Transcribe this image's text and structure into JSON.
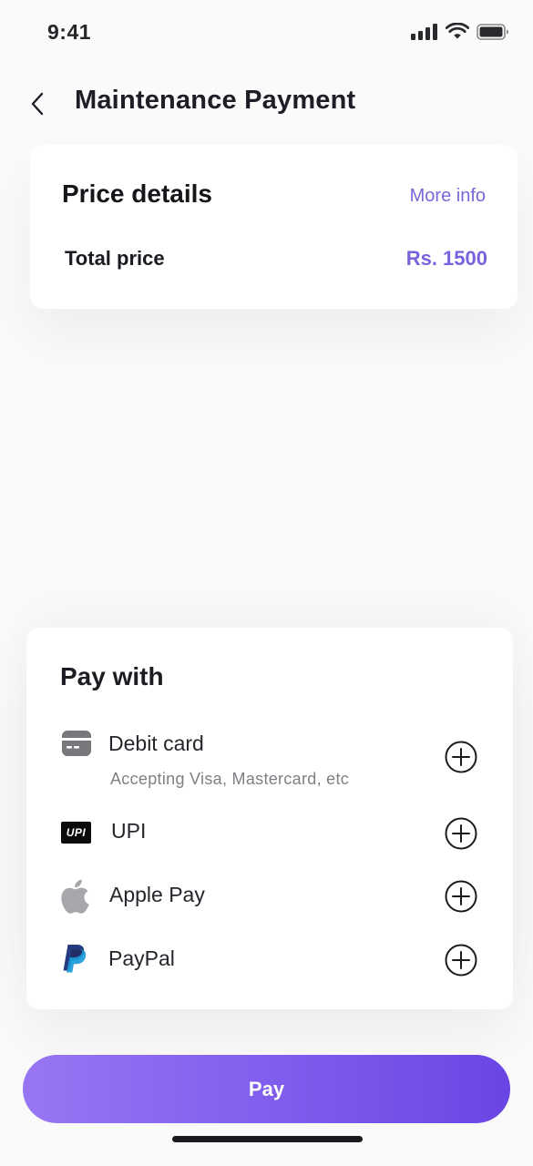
{
  "status_bar": {
    "time": "9:41",
    "icons": [
      "signal-icon",
      "wifi-icon",
      "battery-icon"
    ]
  },
  "header": {
    "title": "Maintenance Payment",
    "back_icon": "chevron-left-icon"
  },
  "price_details": {
    "title": "Price details",
    "more_info": "More info",
    "total_label": "Total price",
    "total_value": "Rs. 1500"
  },
  "pay_with": {
    "title": "Pay with",
    "methods": [
      {
        "label": "Debit card",
        "subtitle": "Accepting Visa, Mastercard, etc",
        "icon": "credit-card-icon"
      },
      {
        "label": "UPI",
        "icon": "upi-logo-icon",
        "icon_text": "UPI"
      },
      {
        "label": "Apple Pay",
        "icon": "apple-icon"
      },
      {
        "label": "PayPal",
        "icon": "paypal-icon"
      }
    ],
    "add_icon": "plus-circle-icon"
  },
  "pay_button": {
    "label": "Pay"
  },
  "colors": {
    "accent": "#7a62dc",
    "button_gradient_start": "#9876f3",
    "button_gradient_end": "#6b45e4",
    "background": "#fafafa",
    "card": "#ffffff"
  }
}
